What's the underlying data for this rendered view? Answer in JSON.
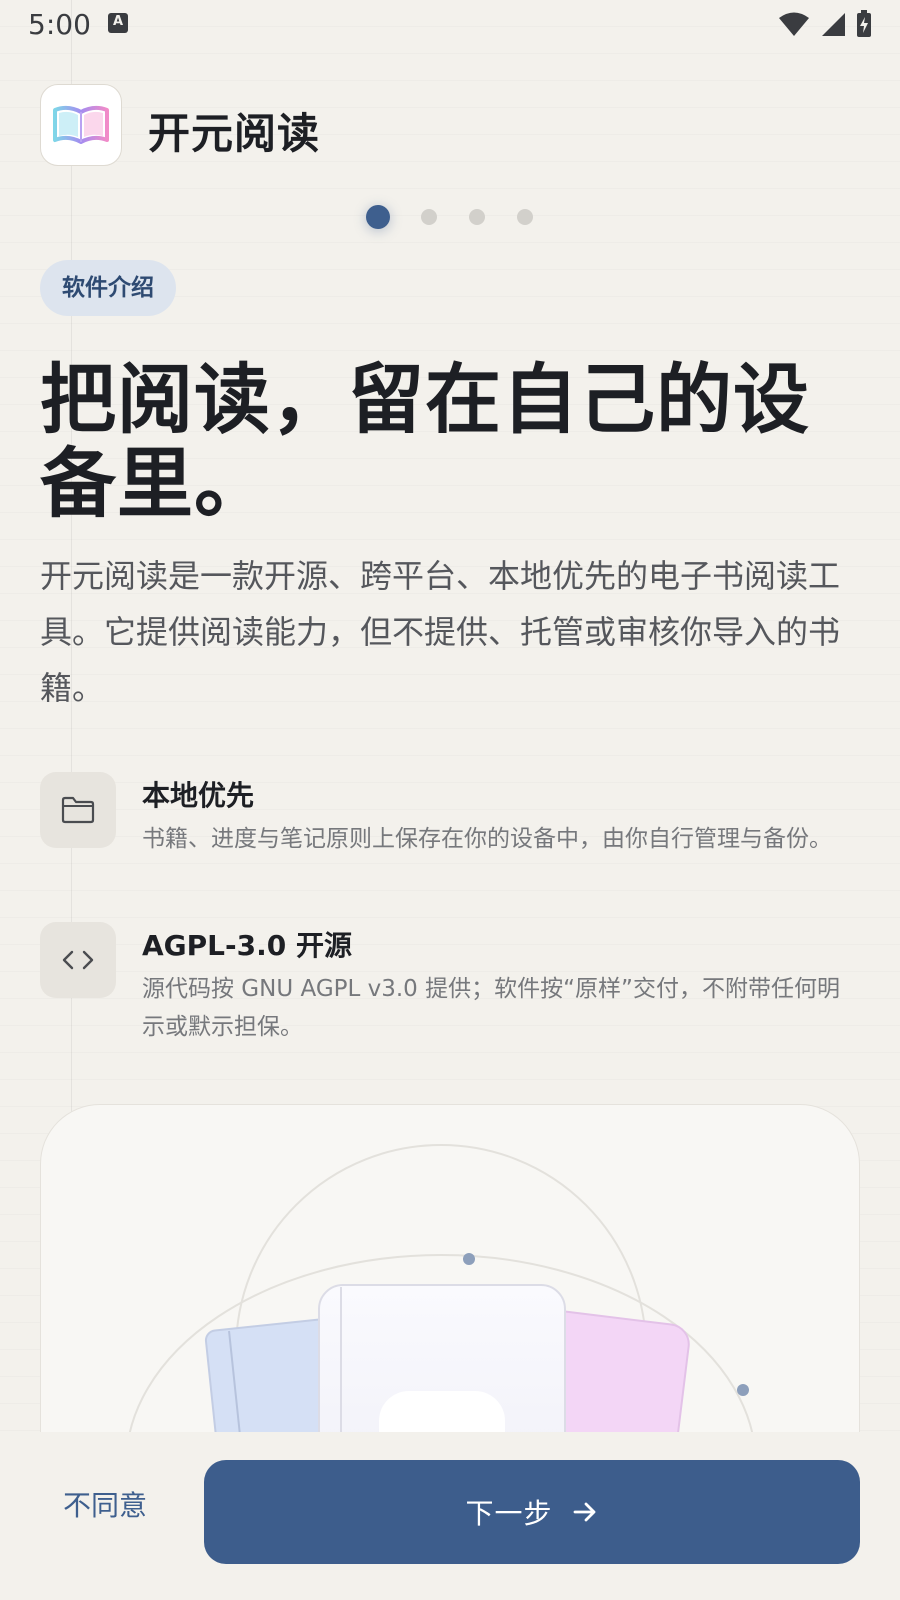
{
  "status_bar": {
    "time": "5:00",
    "notification_icon": "text-a-icon",
    "icons": [
      "wifi-icon",
      "signal-icon",
      "battery-charging-icon"
    ]
  },
  "header": {
    "app_name": "开元阅读",
    "app_icon": "open-book-icon"
  },
  "pager": {
    "total": 4,
    "current": 1
  },
  "chip": {
    "label": "软件介绍"
  },
  "headline": "把阅读，留在自己的设备里。",
  "description": "开元阅读是一款开源、跨平台、本地优先的电子书阅读工具。它提供阅读能力，但不提供、托管或审核你导入的书籍。",
  "features": [
    {
      "icon": "folder-icon",
      "title": "本地优先",
      "description": "书籍、进度与笔记原则上保存在你的设备中，由你自行管理与备份。"
    },
    {
      "icon": "code-icon",
      "title": "AGPL-3.0 开源",
      "description": "源代码按 GNU AGPL v3.0 提供；软件按“原样”交付，不附带任何明示或默示担保。"
    }
  ],
  "actions": {
    "disagree_label": "不同意",
    "next_label": "下一步",
    "next_icon": "arrow-right-icon"
  },
  "colors": {
    "accent": "#3d5d8c",
    "background": "#f3f1ec",
    "chip_bg": "#dde4ee"
  }
}
